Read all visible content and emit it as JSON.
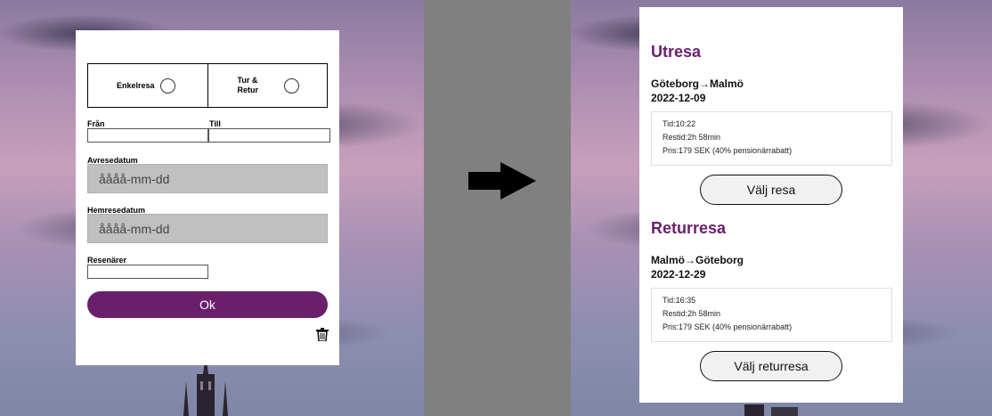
{
  "form": {
    "one_way_label": "Enkelresa",
    "round_trip_label": "Tur & Retur",
    "from_label": "Från",
    "to_label": "Till",
    "from_value": "",
    "to_value": "",
    "departure_label": "Avresedatum",
    "departure_placeholder": "åååå-mm-dd",
    "return_label": "Hemresedatum",
    "return_placeholder": "åååå-mm-dd",
    "travelers_label": "Resenärer",
    "travelers_value": "",
    "ok_label": "Ok"
  },
  "results": {
    "outbound": {
      "heading": "Utresa",
      "route": "Göteborg→Malmö",
      "date": "2022-12-09",
      "time": "Tid:10:22",
      "duration": "Restid:2h 58min",
      "price": "Pris:179 SEK (40% pensionärrabatt)",
      "button": "Välj resa"
    },
    "inbound": {
      "heading": "Returresa",
      "route": "Malmö→Göteborg",
      "date": "2022-12-29",
      "time": "Tid:16:35",
      "duration": "Restid:2h 58min",
      "price": "Pris:179 SEK (40% pensionärrabatt)",
      "button": "Välj returresa"
    }
  },
  "icons": {
    "arrow": "right-arrow-icon",
    "trash": "trash-icon"
  },
  "colors": {
    "brand": "#6a1f6d",
    "middle_panel": "#808080"
  }
}
